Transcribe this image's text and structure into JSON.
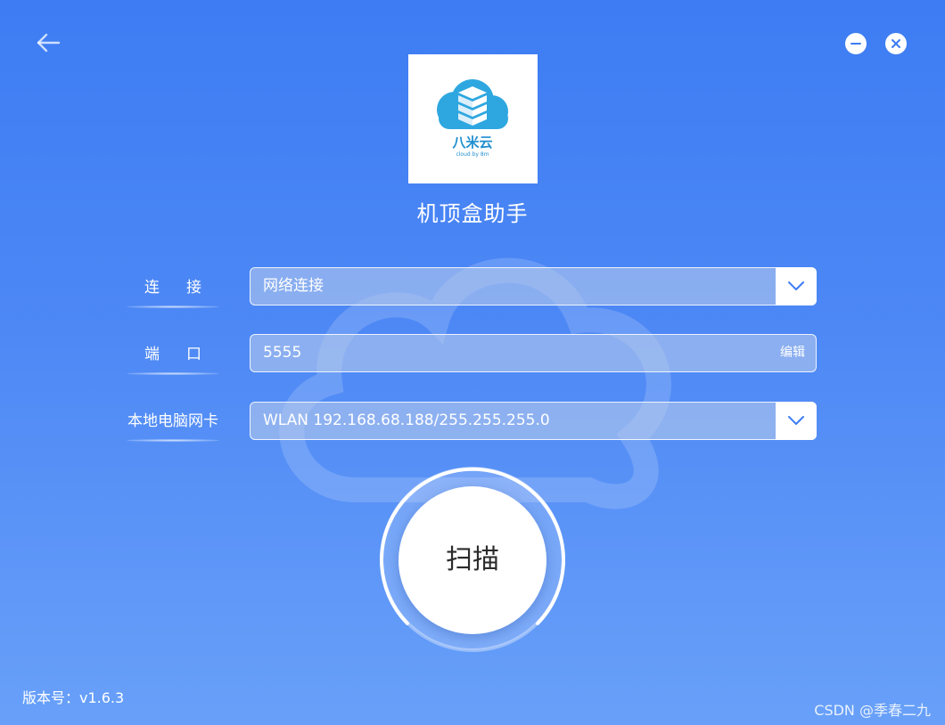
{
  "app": {
    "title": "机顶盒助手",
    "logo_text": "八米云",
    "logo_subtext": "cloud by 8m"
  },
  "window": {
    "back_icon": "arrow-left-icon",
    "minimize_icon": "minus-icon",
    "close_icon": "close-x-icon"
  },
  "form": {
    "connection": {
      "label": "连接",
      "value": "网络连接",
      "icon": "chevron-down-icon"
    },
    "port": {
      "label": "端口",
      "value": "5555",
      "edit_label": "编辑"
    },
    "nic": {
      "label": "本地电脑网卡",
      "value": "WLAN 192.168.68.188/255.255.255.0",
      "icon": "chevron-down-icon"
    }
  },
  "scan": {
    "label": "扫描"
  },
  "footer": {
    "version": "版本号：v1.6.3",
    "watermark": "CSDN @季春二九"
  },
  "colors": {
    "bg_top": "#3d7cf3",
    "bg_bottom": "#68a0f9",
    "logo_blue": "#2ea7e0",
    "field_bg": "rgba(190,205,235,0.55)",
    "chevron": "#3d7cf3"
  }
}
